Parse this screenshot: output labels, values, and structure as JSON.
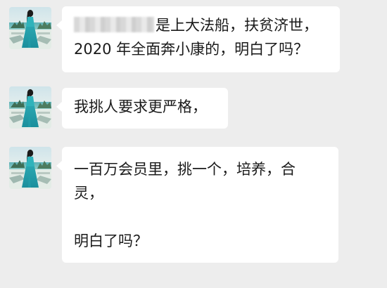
{
  "colors": {
    "background": "#ededed",
    "bubble": "#ffffff",
    "text": "#1a1a1a"
  },
  "messages": [
    {
      "sender_avatar": "avatar-woman-in-teal-dress",
      "redacted_prefix": true,
      "lines": [
        "是上大法船，扶贫济世，",
        "2020 年全面奔小康的，明白了吗？"
      ]
    },
    {
      "sender_avatar": "avatar-woman-in-teal-dress",
      "redacted_prefix": false,
      "lines": [
        "我挑人要求更严格，"
      ]
    },
    {
      "sender_avatar": "avatar-woman-in-teal-dress",
      "redacted_prefix": false,
      "lines": [
        "一百万会员里，挑一个，培养，合",
        "灵，",
        "",
        "明白了吗？"
      ]
    }
  ]
}
